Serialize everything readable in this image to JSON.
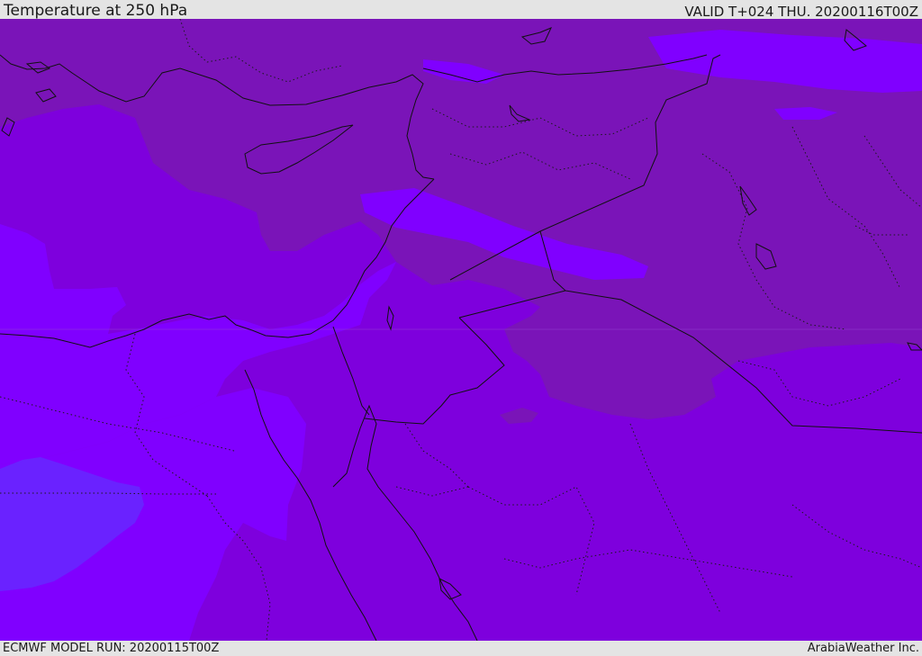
{
  "header": {
    "title": "Temperature at 250 hPa",
    "valid": "VALID T+024 THU. 20200116T00Z"
  },
  "footer": {
    "model_run": "ECMWF MODEL RUN: 20200115T00Z",
    "credit": "ArabiaWeather Inc."
  },
  "colors": {
    "dark_purple": "#7a14b8",
    "purple": "#7e00dd",
    "violet": "#8000ff",
    "blue_violet": "#6a22ff",
    "border": "#111111",
    "bar_bg": "#e4e4e4"
  }
}
